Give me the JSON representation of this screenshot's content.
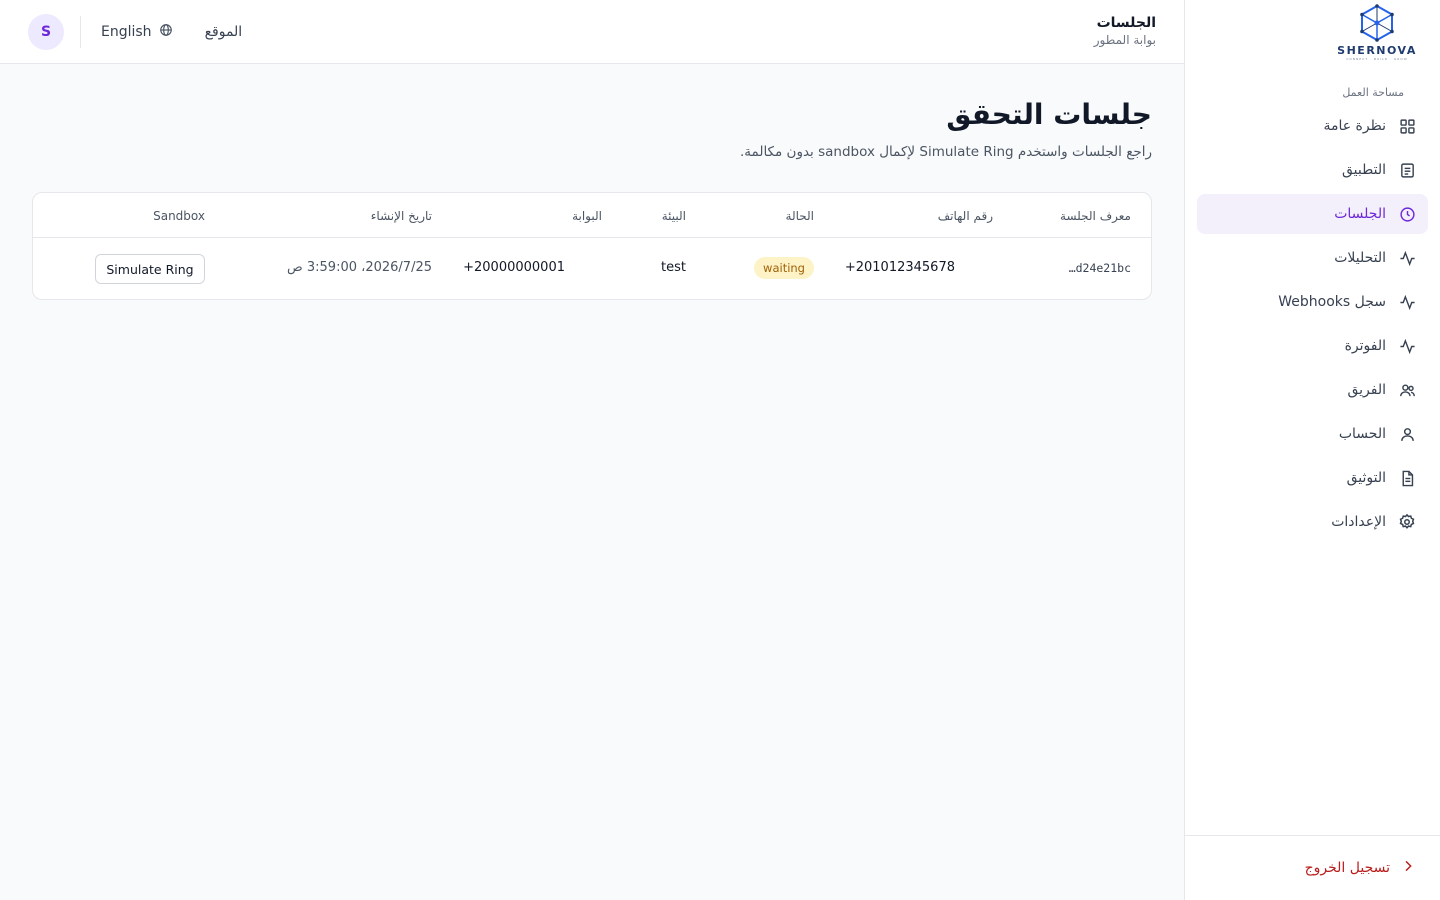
{
  "brand": {
    "name": "SHERNOVA",
    "tagline": "CONNECT · BUILD · GROW"
  },
  "sidebar": {
    "section_label": "مساحة العمل",
    "items": [
      {
        "label": "نظرة عامة",
        "icon": "grid-icon"
      },
      {
        "label": "التطبيق",
        "icon": "document-list-icon"
      },
      {
        "label": "الجلسات",
        "icon": "clock-icon",
        "active": true
      },
      {
        "label": "التحليلات",
        "icon": "activity-icon"
      },
      {
        "label": "سجل Webhooks",
        "icon": "activity-icon"
      },
      {
        "label": "الفوترة",
        "icon": "activity-icon"
      },
      {
        "label": "الفريق",
        "icon": "users-icon"
      },
      {
        "label": "الحساب",
        "icon": "user-icon"
      },
      {
        "label": "التوثيق",
        "icon": "file-text-icon"
      },
      {
        "label": "الإعدادات",
        "icon": "gear-icon"
      }
    ],
    "logout_label": "تسجيل الخروج"
  },
  "header": {
    "title": "الجلسات",
    "subtitle": "بوابة المطور",
    "site_link": "الموقع",
    "language": "English",
    "avatar_initial": "S"
  },
  "main": {
    "title": "جلسات التحقق",
    "subtitle": "راجع الجلسات واستخدم Simulate Ring لإكمال sandbox بدون مكالمة."
  },
  "table": {
    "columns": [
      "معرف الجلسة",
      "رقم الهاتف",
      "الحالة",
      "البيئة",
      "البوابة",
      "تاريخ الإنشاء",
      "Sandbox"
    ],
    "rows": [
      {
        "session_id": "…d24e21bc",
        "phone": "+201012345678",
        "status": "waiting",
        "environment": "test",
        "gateway": "+20000000001",
        "created_at": "2026/7/25، 3:59:00 ص",
        "action_label": "Simulate Ring"
      }
    ]
  },
  "colors": {
    "accent": "#6d28d9",
    "active_bg": "#f3f0fb",
    "status_waiting_bg": "#fef3c7",
    "status_waiting_fg": "#a16207",
    "logout": "#b91c1c"
  }
}
